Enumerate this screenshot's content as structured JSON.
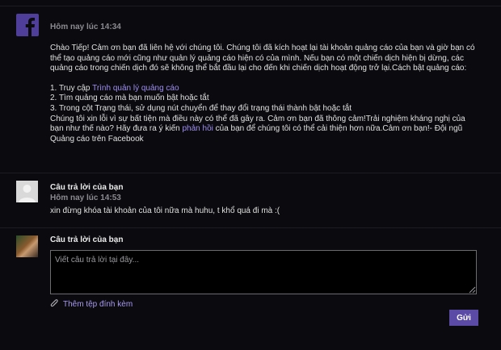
{
  "message": {
    "timestamp": "Hôm nay lúc 14:34",
    "intro": "Chào Tiếp! Cảm ơn bạn đã liên hệ với chúng tôi. Chúng tôi đã kích hoạt lại tài khoản quảng cáo của bạn và giờ bạn có thể tạo quảng cáo mới cũng như quản lý quảng cáo hiện có của mình. Nếu bạn có một chiến dịch hiện bị dừng, các quảng cáo trong chiến dịch đó sẽ không thể bắt đầu lại cho đến khi chiến dịch hoạt động trở lại.Cách bật quảng cáo:",
    "step1_prefix": "1. Truy cập ",
    "step1_link": "Trình quản lý quảng cáo",
    "step2": "2. Tìm quảng cáo mà bạn muốn bật hoặc tắt",
    "step3": "3. Trong cột Trạng thái, sử dụng nút chuyển để thay đổi trạng thái thành bật hoặc tắt",
    "closing_prefix": "Chúng tôi xin lỗi vì sự bất tiện mà điều này có thể đã gây ra. Cảm ơn bạn đã thông cảm!Trải nghiệm kháng nghị của bạn như thế nào? Hãy đưa ra ý kiến ",
    "closing_link": "phản hồi",
    "closing_suffix": " của bạn để chúng tôi có thể cải thiện hơn nữa.Cảm ơn bạn!- Đội ngũ Quảng cáo trên Facebook"
  },
  "reply": {
    "label": "Câu trả lời của bạn",
    "timestamp": "Hôm nay lúc 14:53",
    "text": "xin đừng khóa tài khoản của tôi nữa mà huhu, t khổ quá đi mà :("
  },
  "compose": {
    "label": "Câu trả lời của bạn",
    "placeholder": "Viết câu trả lời tại đây...",
    "attach_label": "Thêm tệp đính kèm",
    "send_label": "Gửi"
  },
  "colors": {
    "brand": "#4f3f9a",
    "accent_link": "#9e8ff0",
    "button": "#5b4aa6",
    "background": "#0b0a0f"
  }
}
